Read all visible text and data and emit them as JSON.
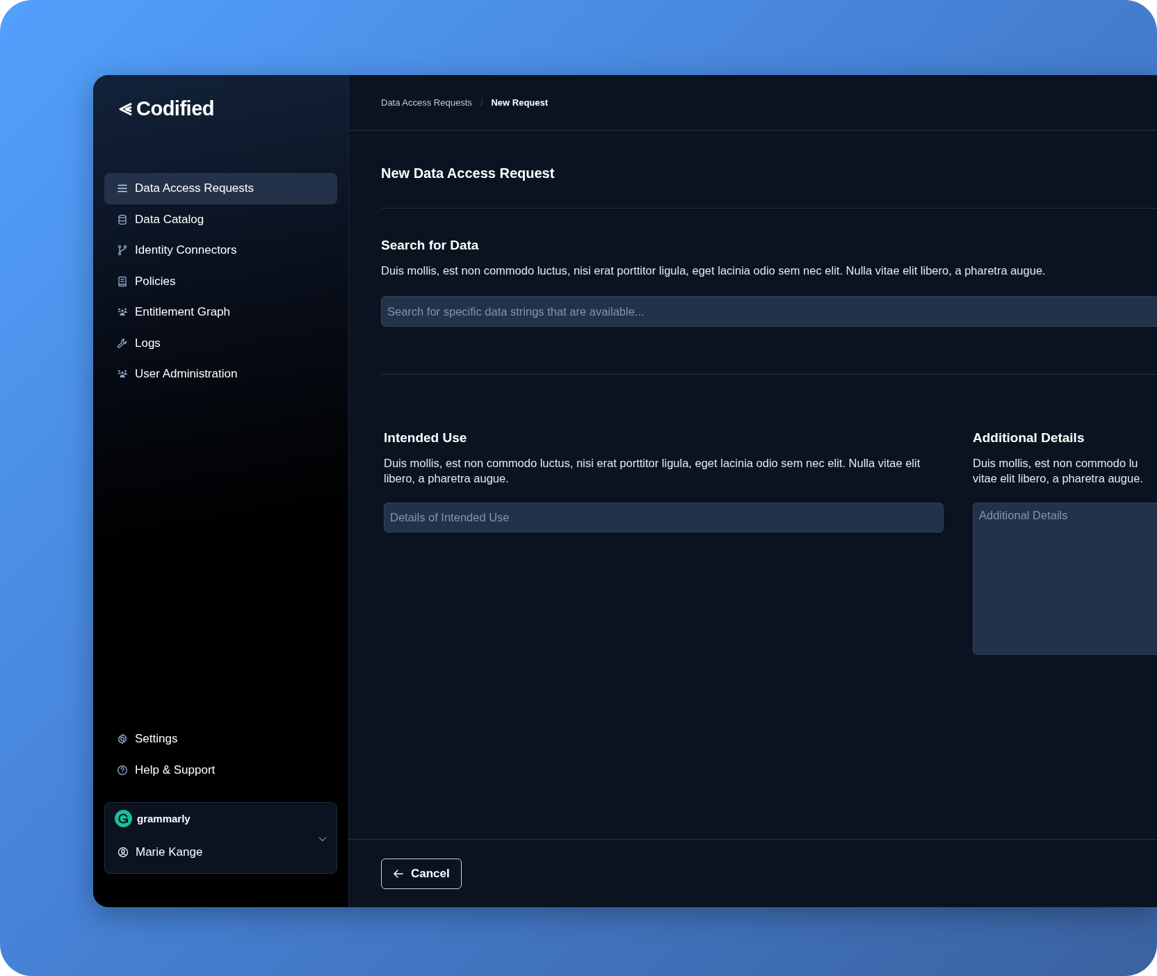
{
  "sidebar": {
    "logo": "Codified",
    "items": [
      {
        "label": "Data Access Requests",
        "kind": "menu",
        "selected": true
      },
      {
        "label": "Data Catalog",
        "kind": "database",
        "selected": false
      },
      {
        "label": "Identity Connectors",
        "kind": "branch",
        "selected": false
      },
      {
        "label": "Policies",
        "kind": "book",
        "selected": false
      },
      {
        "label": "Entitlement Graph",
        "kind": "people",
        "selected": false
      },
      {
        "label": "Logs",
        "kind": "wrench",
        "selected": false
      },
      {
        "label": "User Administration",
        "kind": "people",
        "selected": false
      }
    ],
    "bottom_items": [
      {
        "label": "Settings",
        "kind": "gear",
        "selected": false
      },
      {
        "label": "Help & Support",
        "kind": "help",
        "selected": false
      }
    ],
    "account": {
      "organization": "grammarly",
      "user": "Marie Kange"
    }
  },
  "breadcrumb": [
    {
      "label": "Data Access Requests",
      "selected": false
    },
    {
      "label": "New Request",
      "selected": true
    }
  ],
  "breadcrumb_separator": "/",
  "title": "New Data Access Request",
  "search_section": {
    "heading": "Search for Data",
    "description": "Duis mollis, est non commodo luctus, nisi erat porttitor ligula, eget lacinia odio sem nec elit. Nulla vitae elit libero, a pharetra augue.",
    "placeholder": "Search for specific data strings that are available..."
  },
  "intended_use": {
    "heading": "Intended Use",
    "description": "Duis mollis, est non commodo luctus, nisi erat porttitor ligula, eget lacinia odio sem nec elit. Nulla vitae elit libero, a pharetra augue.",
    "placeholder": "Details of Intended Use"
  },
  "additional_details": {
    "heading": "Additional Details",
    "description_lines": [
      "Duis mollis, est non commodo lu",
      "vitae elit libero, a pharetra augue."
    ],
    "placeholder": "Additional Details"
  },
  "footer": {
    "cancel": "Cancel"
  }
}
